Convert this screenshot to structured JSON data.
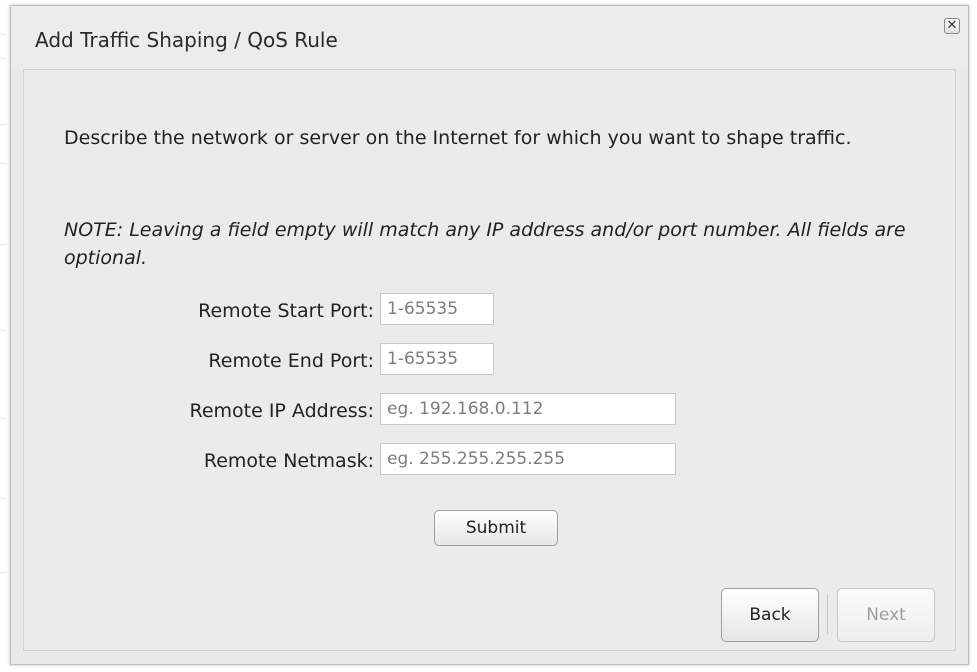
{
  "dialog": {
    "title": "Add Traffic Shaping / QoS Rule",
    "close_glyph": "✕"
  },
  "content": {
    "description": "Describe the network or server on the Internet for which you want to shape traffic.",
    "note": "NOTE: Leaving a field empty will match any IP address and/or port number. All fields are optional."
  },
  "form": {
    "fields": [
      {
        "label": "Remote Start Port:",
        "value": "",
        "placeholder": "1-65535"
      },
      {
        "label": "Remote End Port:",
        "value": "",
        "placeholder": "1-65535"
      },
      {
        "label": "Remote IP Address:",
        "value": "",
        "placeholder": "eg. 192.168.0.112"
      },
      {
        "label": "Remote Netmask:",
        "value": "",
        "placeholder": "eg. 255.255.255.255"
      }
    ],
    "submit_label": "Submit"
  },
  "footer": {
    "back_label": "Back",
    "next_label": "Next",
    "next_disabled": true
  },
  "icons": {
    "close": "close-icon"
  }
}
